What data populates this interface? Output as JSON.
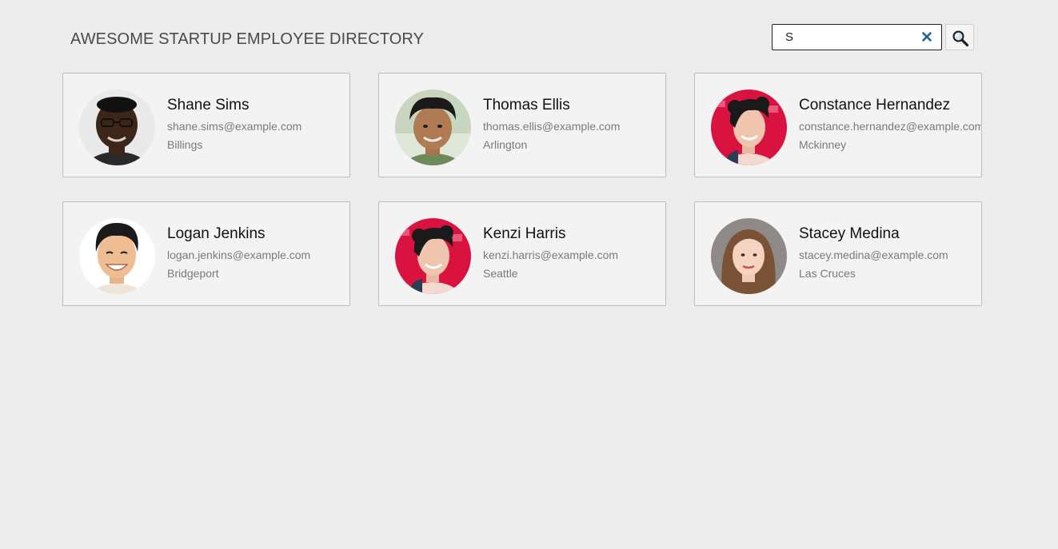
{
  "header": {
    "title": "AWESOME STARTUP EMPLOYEE DIRECTORY"
  },
  "search": {
    "value": "S",
    "clear_icon": "close-icon",
    "button_icon": "magnifier-icon"
  },
  "employees": [
    {
      "name": "Shane Sims",
      "email": "shane.sims@example.com",
      "city": "Billings"
    },
    {
      "name": "Thomas Ellis",
      "email": "thomas.ellis@example.com",
      "city": "Arlington"
    },
    {
      "name": "Constance Hernandez",
      "email": "constance.hernandez@example.com",
      "city": "Mckinney"
    },
    {
      "name": "Logan Jenkins",
      "email": "logan.jenkins@example.com",
      "city": "Bridgeport"
    },
    {
      "name": "Kenzi Harris",
      "email": "kenzi.harris@example.com",
      "city": "Seattle"
    },
    {
      "name": "Stacey Medina",
      "email": "stacey.medina@example.com",
      "city": "Las Cruces"
    }
  ],
  "colors": {
    "background": "#ececec",
    "card_background": "#f3f3f3",
    "card_border": "#bdbdbd",
    "clear_icon": "#1f5f99",
    "avatar_red_backdrop": "#d9123f"
  }
}
